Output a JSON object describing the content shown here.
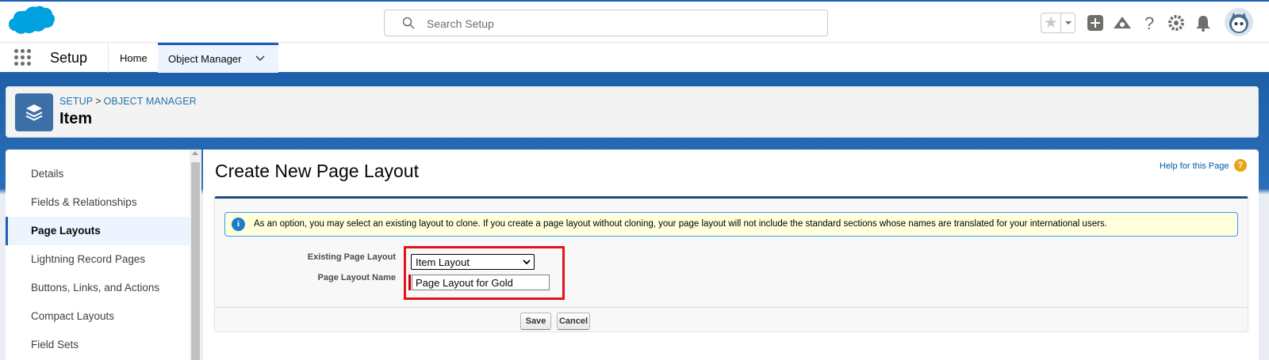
{
  "header": {
    "search_placeholder": "Search Setup",
    "brand_color": "#00a1e0"
  },
  "context_bar": {
    "app_name": "Setup",
    "tabs": [
      {
        "label": "Home"
      },
      {
        "label": "Object Manager"
      }
    ]
  },
  "object_header": {
    "breadcrumb": [
      "SETUP",
      ">",
      "OBJECT MANAGER"
    ],
    "title": "Item"
  },
  "sidebar": {
    "items": [
      {
        "label": "Details"
      },
      {
        "label": "Fields & Relationships"
      },
      {
        "label": "Page Layouts"
      },
      {
        "label": "Lightning Record Pages"
      },
      {
        "label": "Buttons, Links, and Actions"
      },
      {
        "label": "Compact Layouts"
      },
      {
        "label": "Field Sets"
      }
    ],
    "active_index": 2
  },
  "main": {
    "title": "Create New Page Layout",
    "help_label": "Help for this Page",
    "info_message": "As an option, you may select an existing layout to clone. If you create a page layout without cloning, your page layout will not include the standard sections whose names are translated for your international users.",
    "form": {
      "existing_label": "Existing Page Layout",
      "existing_value": "Item Layout",
      "name_label": "Page Layout Name",
      "name_value": "Page Layout for Gold"
    },
    "save_label": "Save",
    "cancel_label": "Cancel"
  }
}
